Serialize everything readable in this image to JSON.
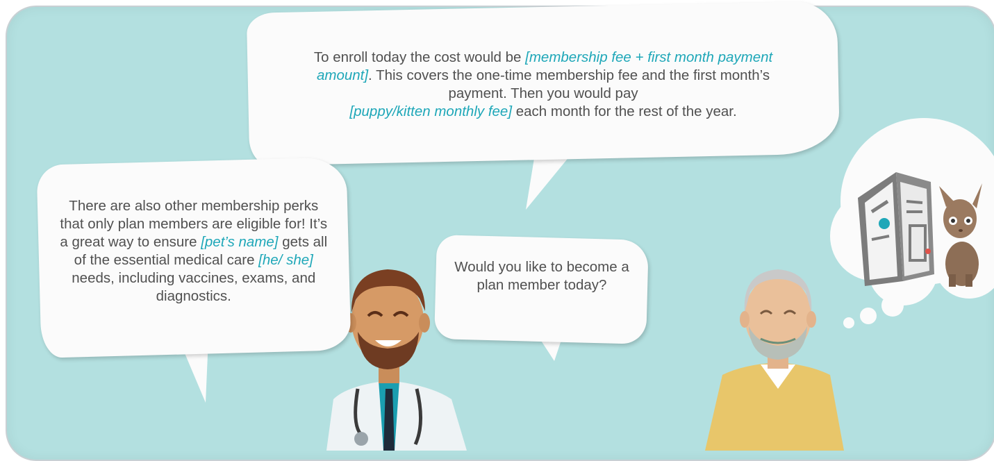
{
  "bubbles": {
    "top": {
      "line1_pre": "To enroll today the cost would be ",
      "line1_ph": "[membership fee + first month payment amount]",
      "line1_post": ". This covers the one-time membership fee and the first month’s payment. Then you would pay ",
      "line2_ph": "[puppy/kitten monthly fee]",
      "line2_post": " each month for the rest of the year."
    },
    "left": {
      "part1": "There are also other membership perks that only plan members are eligible for! It’s a great way to ensure ",
      "ph1": "[pet’s name]",
      "part2": "  gets all of the essential medical care ",
      "ph2": "[he/ she]",
      "part3": " needs, including vaccines, exams, and diagnostics."
    },
    "mid": {
      "text": "Would you like to become a plan member today?"
    }
  },
  "colors": {
    "background": "#b3e0e0",
    "bubble": "#fbfbfb",
    "text": "#505050",
    "placeholder": "#1ea7b8"
  }
}
